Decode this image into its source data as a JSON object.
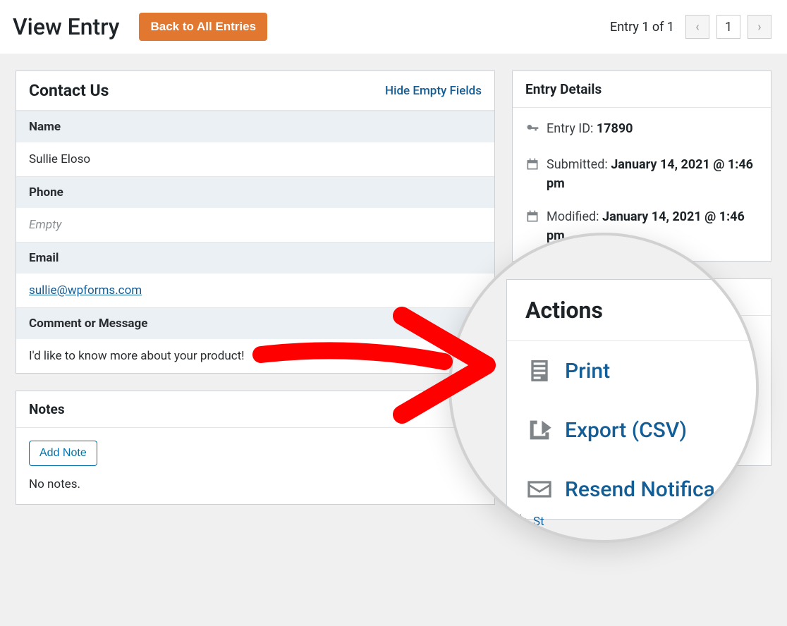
{
  "header": {
    "title": "View Entry",
    "back_button": "Back to All Entries",
    "pager_text": "Entry 1 of 1",
    "page_num": "1"
  },
  "form": {
    "title": "Contact Us",
    "hide_link": "Hide Empty Fields",
    "fields": {
      "name_label": "Name",
      "name_value": "Sullie Eloso",
      "phone_label": "Phone",
      "phone_value": "Empty",
      "email_label": "Email",
      "email_value": "sullie@wpforms.com",
      "comment_label": "Comment or Message",
      "comment_value": "I'd like to know more about your product!"
    }
  },
  "notes": {
    "title": "Notes",
    "add_btn": "Add Note",
    "empty": "No notes."
  },
  "details": {
    "title": "Entry Details",
    "entry_id_label": "Entry ID:",
    "entry_id": "17890",
    "submitted_label": "Submitted:",
    "submitted": "January 14, 2021 @ 1:46 pm",
    "modified_label": "Modified:",
    "modified": "January 14, 2021 @ 1:46 pm"
  },
  "actions": {
    "title": "Actions",
    "print": "Print",
    "export": "Export (CSV)",
    "resend": "Resend Notifications",
    "resend_trunc": "Resend Notifica",
    "star": "Star",
    "star_trunc": "St"
  }
}
